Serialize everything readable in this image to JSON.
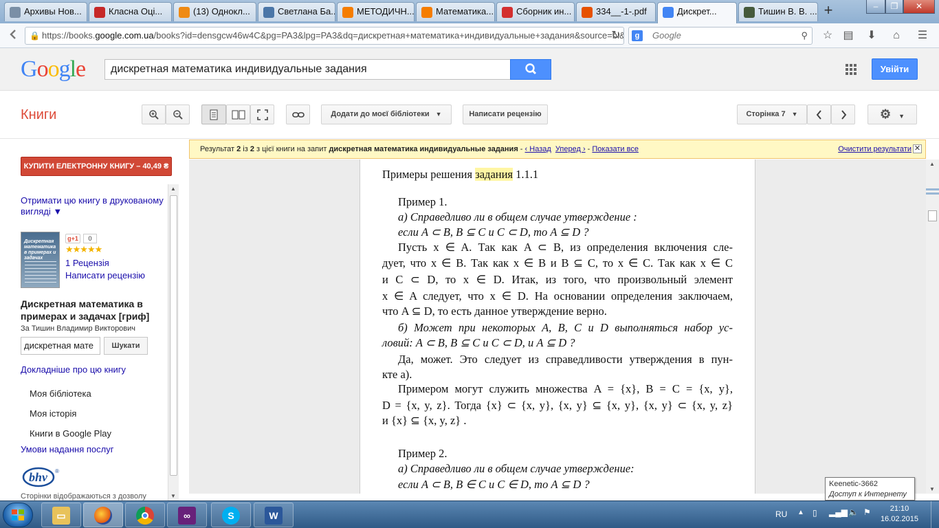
{
  "browser": {
    "tabs": [
      {
        "label": "Архивы Нов...",
        "icon": "page-icon",
        "color": "#7a8fa6"
      },
      {
        "label": "Класна Оці...",
        "icon": "shield-icon",
        "color": "#c62828"
      },
      {
        "label": "(13) Однокл...",
        "icon": "ok-icon",
        "color": "#ef8a13"
      },
      {
        "label": "Светлана Ба...",
        "icon": "vk-icon",
        "color": "#4a76a8"
      },
      {
        "label": "МЕТОДИЧН...",
        "icon": "blogger-icon",
        "color": "#f57d00"
      },
      {
        "label": "Математика...",
        "icon": "blogger-icon",
        "color": "#f57d00"
      },
      {
        "label": "Сборник ин...",
        "icon": "ab-icon",
        "color": "#d32f2f"
      },
      {
        "label": "334__-1-.pdf",
        "icon": "pdf-icon",
        "color": "#e65100"
      },
      {
        "label": "Дискрет...",
        "icon": "google-icon",
        "color": "#4285f4"
      },
      {
        "label": "Тишин В. В. ...",
        "icon": "bn-icon",
        "color": "#455a3c"
      }
    ],
    "new_tab": "+",
    "url_domain_prefix": "https://books.",
    "url_domain": "google.com.ua",
    "url_rest": "/books?id=densgcw46w4C&pg=PA3&lpg=PA3&dq=дискретная+математика+индивидуальные+задания&source=bl&ots",
    "search_placeholder": "Google"
  },
  "google": {
    "logo": "Google",
    "query": "дискретная математика индивидуальные задания",
    "signin": "Увійти"
  },
  "toolbar": {
    "title": "Книги",
    "add_to_library": "Додати до моєї бібліотеки",
    "write_review": "Написати рецензію",
    "page_label": "Сторінка 7"
  },
  "sidebar": {
    "buy": "КУПИТИ ЕЛЕКТРОННУ КНИГУ – 40,49 ₴",
    "print_link_1": "Отримати цю книгу в друкованому",
    "print_link_2": "вигляді ▼",
    "gplus": "+1",
    "gplus_count": "0",
    "stars": "★★★★★",
    "reviews": "1 Рецензія",
    "write_review": "Написати рецензію",
    "book_title_1": "Дискретная математика в",
    "book_title_2": "примерах и задачах [гриф]",
    "author": "За Тишин Владимир Викторович",
    "cover_title": "Дискретная математика в примерах и задачах",
    "search_value": "дискретная мате",
    "search_btn": "Шукати",
    "about": "Докладніше про цю книгу",
    "my_library": "Моя бібліотека",
    "my_history": "Моя історія",
    "google_play": "Книги в Google Play",
    "terms": "Умови надання послуг",
    "publisher_logo": "bhv",
    "pages_note": "Сторінки відображаються з дозволу"
  },
  "banner": {
    "prefix": "Результат ",
    "n": "2",
    "mid": " із ",
    "total": "2",
    "suffix": " з цієї книги на запит ",
    "query": "дискретная математика индивидуальные задания",
    "sep1": " - ",
    "back": "‹ Назад",
    "forward": "Уперед ›",
    "sep2": " - ",
    "show_all": "Показати все",
    "clear": "Очистити результати"
  },
  "page": {
    "heading_pre": "Примеры решения ",
    "heading_hl": "задания",
    "heading_post": " 1.1.1",
    "lines": [
      "Пример 1.",
      "а) Справедливо ли в общем случае утверждение :",
      "если  A ⊂ B,  B ⊆ C  и  C ⊂ D,  то  A ⊆ D ?",
      "Пусть  x ∈ A.  Так как  A ⊂ B,  из определения включения сле-",
      "дует, что  x ∈ B.  Так как  x ∈ B и  B ⊆ C,  то  x ∈ C.  Так как  x ∈ C",
      "и  C ⊂ D,  то  x ∈ D.  Итак, из того, что произвольный элемент",
      "x ∈ A  следует, что  x ∈ D.  На основании определения заключаем,",
      "что  A ⊆ D,  то есть данное утверждение верно.",
      "б) Может при некоторых  A, B, C и D  выполняться набор ус-",
      "ловий:  A ⊂ B,  B ⊆ C  и  C ⊂ D,  и  A ⊆ D ?",
      "Да, может. Это следует из справедливости утверждения в пун-",
      "кте а).",
      "Примером могут служить множества A = {x},   B = C = {x, y},",
      "D = {x, y, z}.    Тогда    {x} ⊂ {x, y},     {x, y} ⊆ {x, y},  {x, y} ⊂ {x, y, z}",
      "и  {x} ⊆ {x, y, z} .",
      "Пример 2.",
      "а) Справедливо ли в общем случае утверждение:",
      "если  A ⊂ B,  B ∈ C  и  C ∈ D,  то  A ⊆ D ?"
    ]
  },
  "tooltip": {
    "line1": "Keenetic-3662",
    "line2": "Доступ к Интернету"
  },
  "taskbar": {
    "lang": "RU",
    "time": "21:10",
    "date": "16.02.2015"
  }
}
